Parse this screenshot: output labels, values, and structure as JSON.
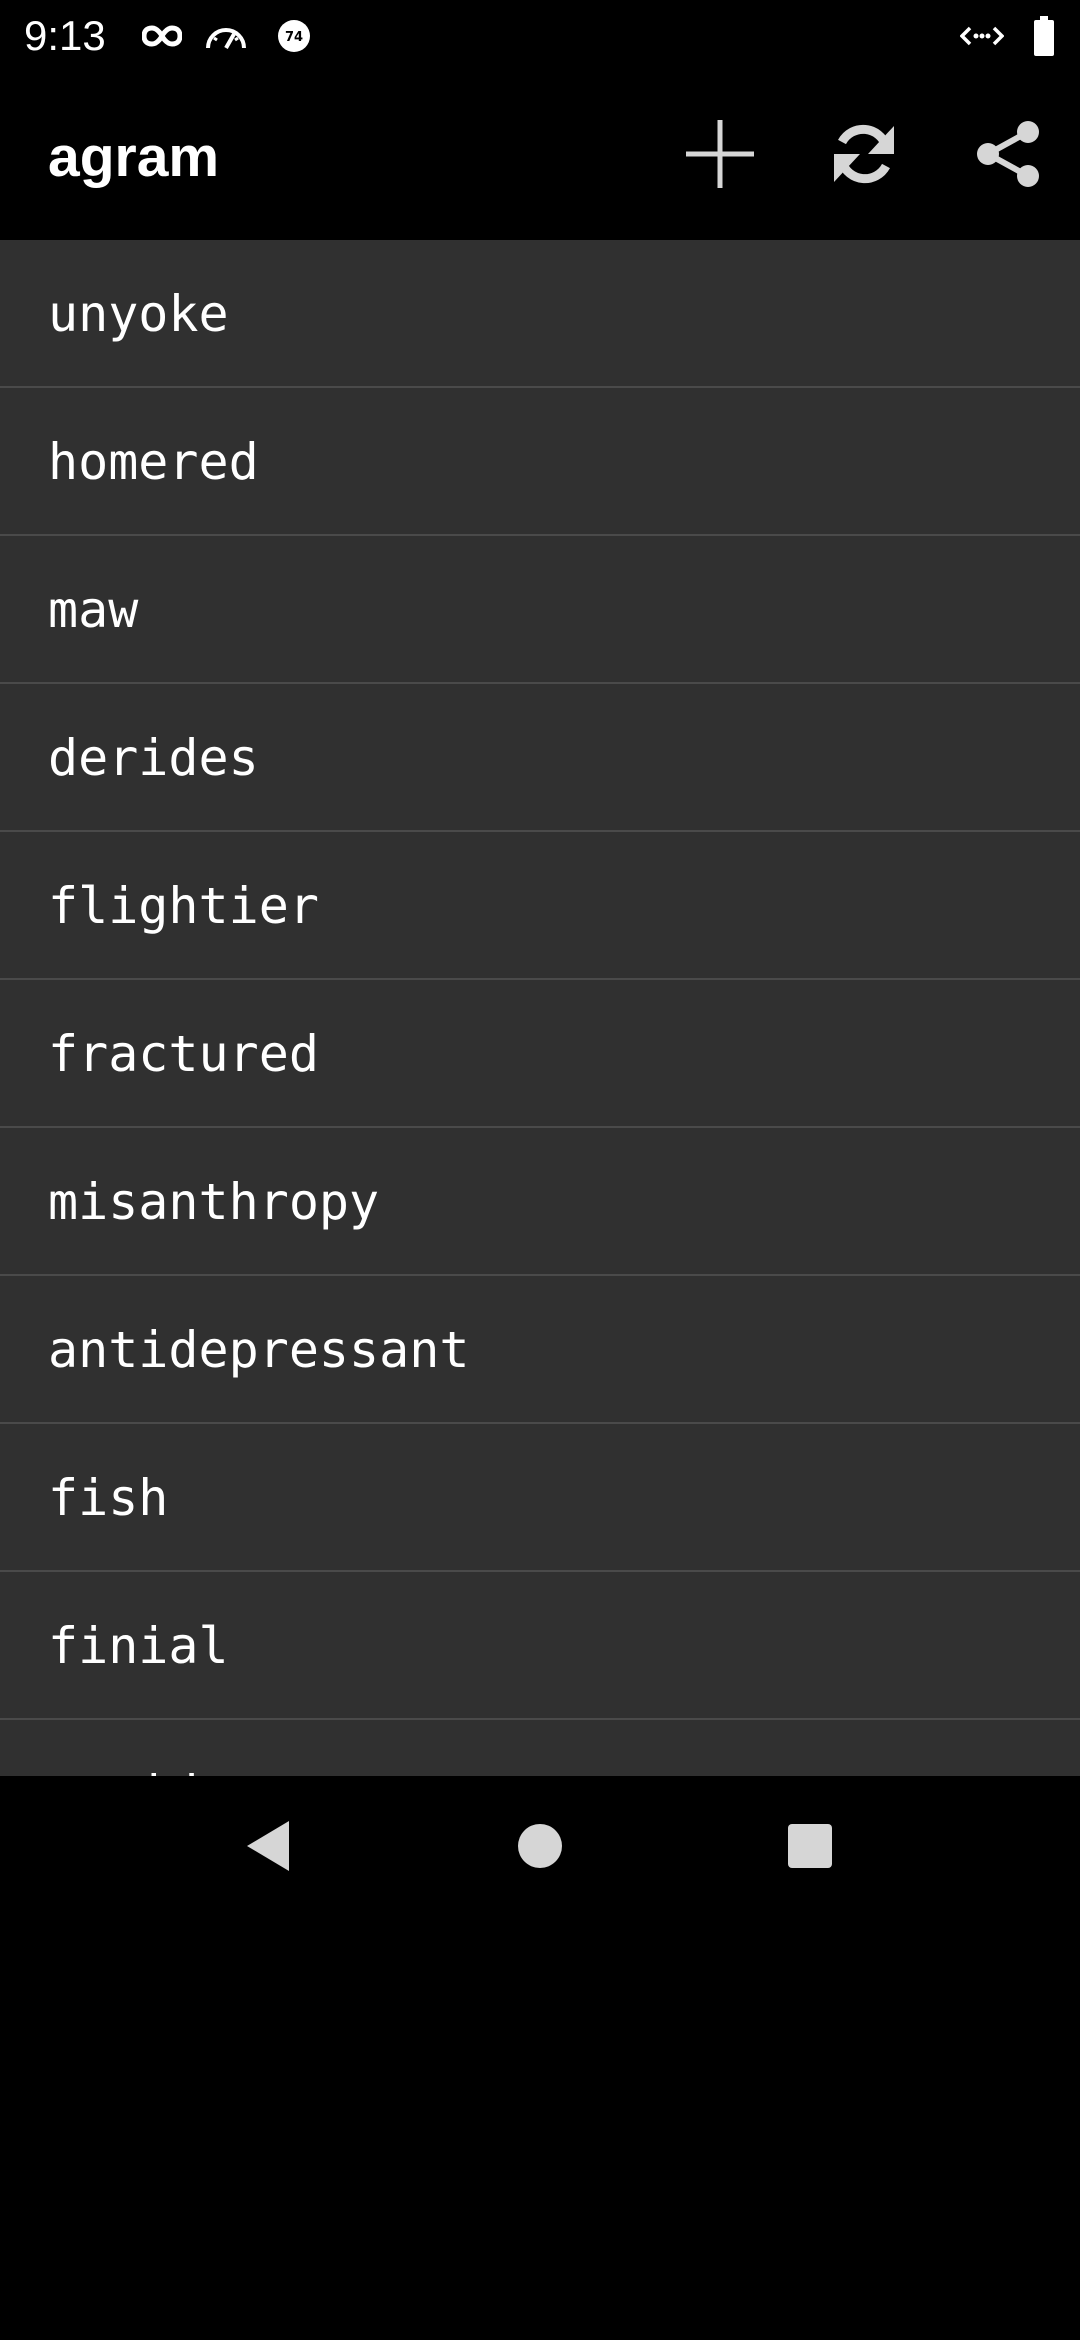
{
  "status_bar": {
    "time": "9:13",
    "icons": [
      "infinity-icon",
      "speedometer-icon",
      "badge-74-icon",
      "code-arrows-icon",
      "battery-icon"
    ],
    "badge_number": "74"
  },
  "app_bar": {
    "title": "agram",
    "actions": [
      "add-icon",
      "refresh-icon",
      "share-icon"
    ]
  },
  "words": [
    "unyoke",
    "homered",
    "maw",
    "derides",
    "flightier",
    "fractured",
    "misanthropy",
    "antidepressant",
    "fish",
    "finial",
    "stridency"
  ],
  "nav_bar": {
    "buttons": [
      "back-icon",
      "home-icon",
      "recents-icon"
    ]
  },
  "colors": {
    "background": "#000000",
    "list_background": "#303030",
    "divider": "#4a4a4a",
    "text": "#ffffff",
    "icon": "#d6d6d6"
  }
}
